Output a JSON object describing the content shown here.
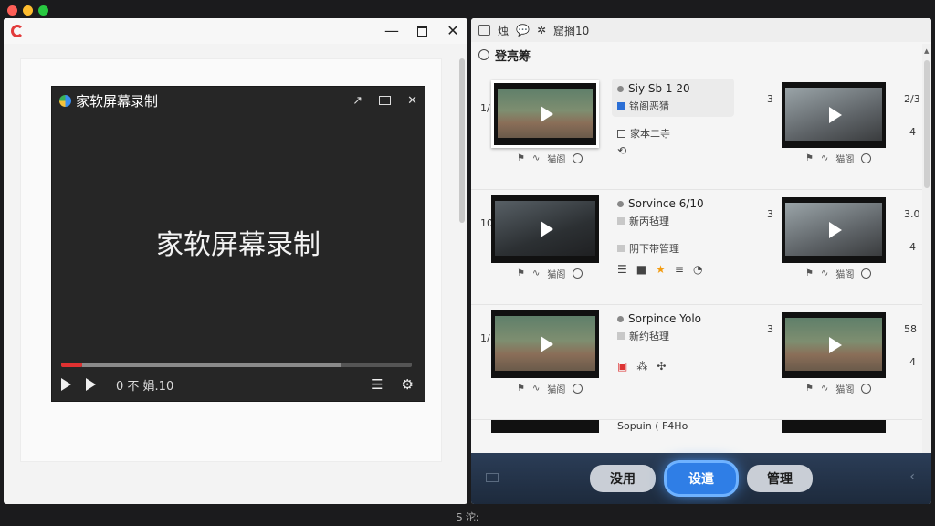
{
  "player": {
    "title": "家软屏幕录制",
    "center_text": "家软屏幕录制",
    "time": "0 不 娟.10",
    "progress_played": 0.06,
    "progress_buffered": 0.8
  },
  "right_panel": {
    "toolbar_label": "窟搁10",
    "toolbar_extra": "烛",
    "section_title": "登亮筹",
    "rows": [
      {
        "num": "1/",
        "title": "Siy Sb 1 20",
        "sub1": "铭阁恶猜",
        "sub2": "家本二寺",
        "tool_label": "猫阁",
        "right_num": "3",
        "right_tool_label": "猫阁",
        "edge_top": "2/3",
        "edge_bottom": "4"
      },
      {
        "num": "10",
        "title": "Sorvince 6/10",
        "sub1": "新丙毡理",
        "sub2": "阴下带管理",
        "tool_label": "猫阁",
        "right_num": "3",
        "right_tool_label": "猫阁",
        "edge_top": "3.0",
        "edge_bottom": "4"
      },
      {
        "num": "1/",
        "title": "Sorpince Yolo",
        "sub1": "新约毡理",
        "tool_label": "猫阁",
        "right_num": "3",
        "right_tool_label": "猫阁",
        "edge_top": "58",
        "edge_bottom": "4"
      }
    ],
    "partial_row_title": "Sopuin ( F4Ho"
  },
  "bottom_tabs": {
    "tab1": "没用",
    "tab2": "设遣",
    "tab3": "管理",
    "active": "tab2"
  },
  "status": "S 沱:",
  "colors": {
    "accent": "#2f7ee6",
    "progress": "#e03131",
    "star": "#f39c12"
  }
}
